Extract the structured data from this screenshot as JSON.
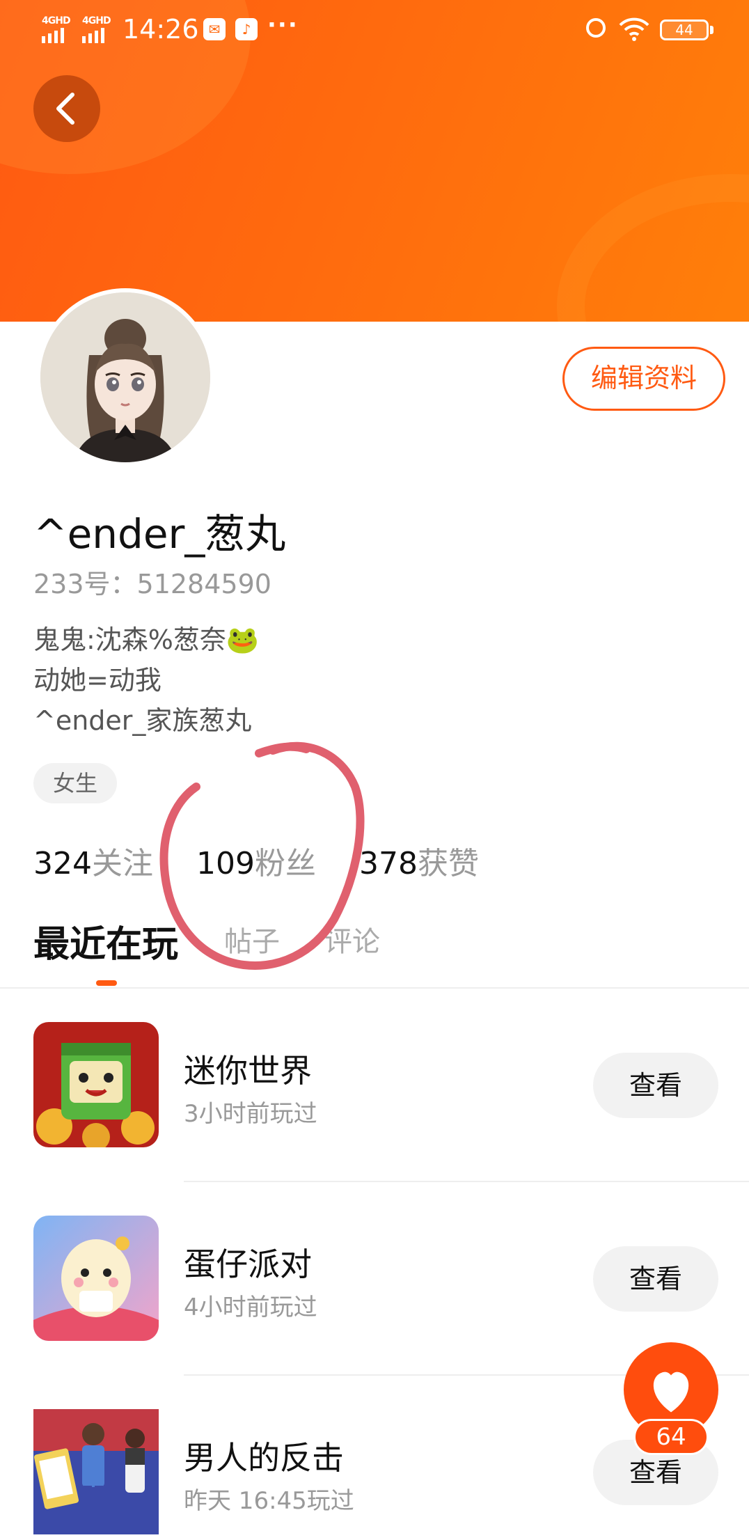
{
  "status_bar": {
    "signal1": "4GHD",
    "signal2": "4GHD",
    "time": "14:26",
    "more": "···",
    "battery": "44",
    "icons": [
      "mail-icon",
      "tiktok-icon",
      "alarm-icon",
      "wifi-icon",
      "battery-icon"
    ]
  },
  "header": {
    "back_icon": "chevron-left-icon",
    "bg_color": "#ff6a10"
  },
  "profile": {
    "edit_button": "编辑资料",
    "name": "^ender_葱丸",
    "uid": "233号：51284590",
    "bio": [
      "鬼鬼:沈森%葱奈🐸",
      "动她=动我",
      "^ender_家族葱丸"
    ],
    "gender_tag": "女生",
    "stats": [
      {
        "num": "324",
        "label": "关注"
      },
      {
        "num": "109",
        "label": "粉丝"
      },
      {
        "num": "378",
        "label": "获赞"
      }
    ]
  },
  "tabs": [
    "最近在玩",
    "帖子",
    "评论"
  ],
  "games": [
    {
      "title": "迷你世界",
      "subtitle": "3小时前玩过",
      "button": "查看"
    },
    {
      "title": "蛋仔派对",
      "subtitle": "4小时前玩过",
      "button": "查看"
    },
    {
      "title": "男人的反击",
      "subtitle": "昨天 16:45玩过",
      "button": "查看"
    }
  ],
  "like": {
    "count": "64",
    "icon": "heart-icon"
  },
  "colors": {
    "accent": "#ff5a12",
    "annotation": "#e0606e"
  }
}
